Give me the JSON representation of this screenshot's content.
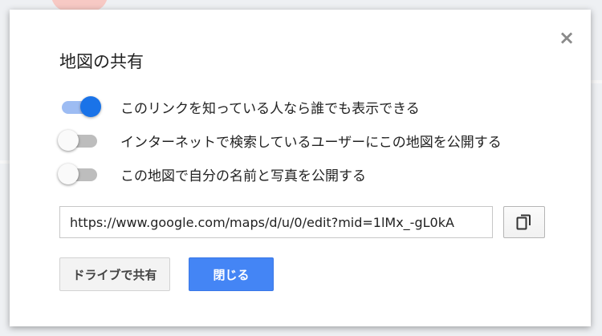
{
  "dialog": {
    "title": "地図の共有",
    "close_symbol": "×",
    "options": [
      {
        "label": "このリンクを知っている人なら誰でも表示できる",
        "enabled": true
      },
      {
        "label": "インターネットで検索しているユーザーにこの地図を公開する",
        "enabled": false
      },
      {
        "label": "この地図で自分の名前と写真を公開する",
        "enabled": false
      }
    ],
    "link_value": "https://www.google.com/maps/d/u/0/edit?mid=1lMx_-gL0kA",
    "copy_icon": "copy-icon",
    "share_drive_label": "ドライブで共有",
    "close_label": "閉じる"
  },
  "colors": {
    "accent": "#1a73e8",
    "toggle_on_track": "#9dbcf3",
    "primary_button": "#4485f5"
  }
}
